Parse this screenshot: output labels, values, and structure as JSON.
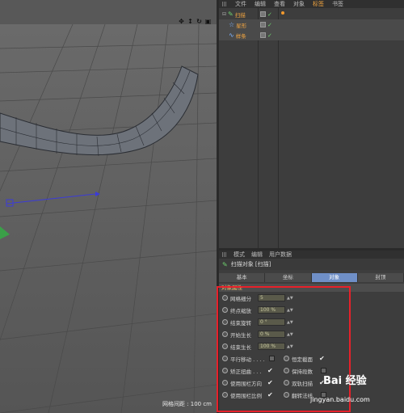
{
  "viewport": {
    "grid_spacing_label": "网格间距 : 100 cm",
    "toolbar_icons": [
      "move-view-icon",
      "zoom-view-icon",
      "rotate-view-icon",
      "maximize-view-icon"
    ]
  },
  "object_manager": {
    "menu": {
      "file": "文件",
      "edit": "编辑",
      "view": "查看",
      "object": "对象",
      "tags": "标签",
      "bookmarks": "书签"
    },
    "objects": [
      {
        "name": "扫描",
        "icon": "sweep-icon",
        "selected": false
      },
      {
        "name": "星形",
        "icon": "star-spline-icon",
        "selected": true
      },
      {
        "name": "样条",
        "icon": "spline-icon",
        "selected": true
      }
    ]
  },
  "attributes": {
    "menu": {
      "mode": "模式",
      "edit": "编辑",
      "user_data": "用户数据"
    },
    "object_title": "扫描对象 [扫描]",
    "tabs": [
      "基本",
      "坐标",
      "对象",
      "封顶"
    ],
    "active_tab": 2,
    "section": "对象属性",
    "fields": [
      {
        "label": "网格细分",
        "value": "5"
      },
      {
        "label": "终点缩放",
        "value": "100 %"
      },
      {
        "label": "结束旋转",
        "value": "0 °"
      },
      {
        "label": "开始生长",
        "value": "0 %"
      },
      {
        "label": "结束生长",
        "value": "100 %"
      }
    ],
    "checkbox_rows": [
      {
        "left_label": "平行移动 . . . .",
        "left_checked": false,
        "right_label": "恒定截面",
        "right_checked": true
      },
      {
        "left_label": "矫正扭曲 . . .",
        "left_checked": true,
        "right_label": "保持段数",
        "right_checked": false
      },
      {
        "left_label": "使用围栏方向",
        "left_checked": true,
        "right_label": "双轨扫描",
        "right_checked": true
      },
      {
        "left_label": "使用围栏比例",
        "left_checked": true,
        "right_label": "翻转法线",
        "right_checked": false
      }
    ]
  },
  "watermark": {
    "logo": "Bai 经验",
    "url": "jingyan.baidu.com"
  }
}
